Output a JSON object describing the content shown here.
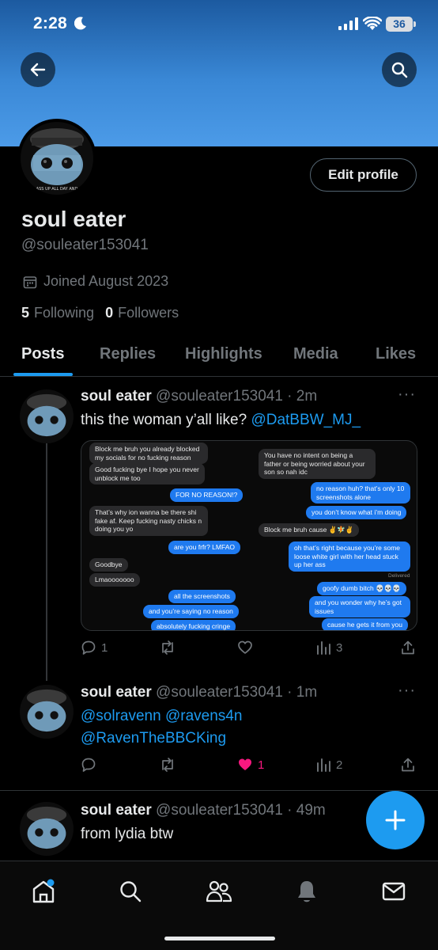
{
  "status_bar": {
    "time": "2:28",
    "battery": "36"
  },
  "profile": {
    "name": "soul eater",
    "handle": "@souleater153041",
    "joined": "Joined August 2023",
    "following_count": "5",
    "following_label": "Following",
    "followers_count": "0",
    "followers_label": "Followers",
    "edit_label": "Edit profile",
    "avatar_caption": "ASS UP ALL DAY AND"
  },
  "tabs": [
    "Posts",
    "Replies",
    "Highlights",
    "Media",
    "Likes"
  ],
  "tweets": [
    {
      "name": "soul eater",
      "meta": "@souleater153041 · 2m",
      "text": "this the woman y’all like?",
      "mention": "@DatBBW_MJ_",
      "replies": "1",
      "likes": "",
      "views": "3"
    },
    {
      "name": "soul eater",
      "meta": "@souleater153041 · 1m",
      "mention_line1a": "@solravenn",
      "mention_line1b": "@ravens4n",
      "mention_line2": "@RavenTheBBCKing",
      "replies": "",
      "likes": "1",
      "views": "2"
    },
    {
      "name": "soul eater",
      "meta": "@souleater153041 · 49m",
      "text": "from lydia btw"
    }
  ],
  "screenshot_left": [
    "Block me bruh you already blocked my socials for no fucking reason",
    "Good fucking bye I hope you never unblock me too",
    "FOR NO REASON!?",
    "That’s why ion wanna be there shi fake af. Keep fucking nasty chicks n doing you yo",
    "are you frfr? LMFAO",
    "Goodbye",
    "Lmaooooooo",
    "all the screenshots",
    "and you’re saying no reason",
    "absolutely fucking cringe"
  ],
  "screenshot_right": [
    "You have no intent on being a father or being worried about your son so nah idc",
    "no reason huh? that’s only 10 screenshots alone",
    "you don’t know what i’m doing",
    "Block me bruh cause ✌️🧚✌️",
    "oh that’s right because you’re some loose white girl with her head stuck up her ass",
    "Delivered",
    "goofy dumb bitch 💀💀💀",
    "and you wonder why he’s got issues",
    "cause he gets it from you"
  ],
  "colors": {
    "accent": "#1d9bf0",
    "like": "#f91880",
    "banner": "#3a88d6"
  }
}
